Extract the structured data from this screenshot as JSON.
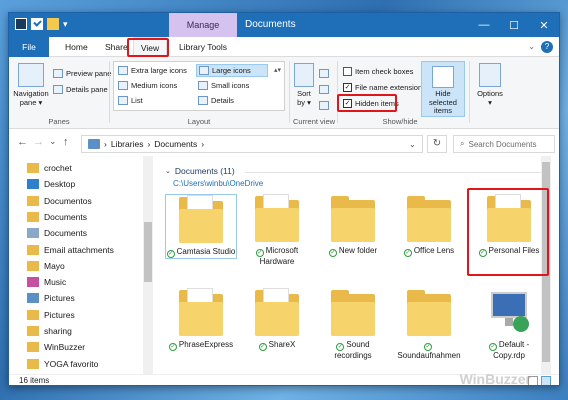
{
  "window": {
    "title": "Documents",
    "manage_tab": "Manage",
    "controls": {
      "minimize": "—",
      "maximize": "☐",
      "close": "✕"
    }
  },
  "tabs": {
    "file": "File",
    "home": "Home",
    "share": "Share",
    "view": "View",
    "library_tools": "Library Tools",
    "help": "?"
  },
  "ribbon": {
    "panes": {
      "navigation_pane": "Navigation",
      "navigation_pane_sub": "pane ▾",
      "preview_pane": "Preview pane",
      "details_pane": "Details pane",
      "label": "Panes"
    },
    "layout": {
      "items": [
        "Extra large icons",
        "Large icons",
        "Medium icons",
        "Small icons",
        "List",
        "Details"
      ],
      "label": "Layout"
    },
    "current_view": {
      "sort_by": "Sort",
      "sort_by_sub": "by ▾",
      "label": "Current view"
    },
    "show_hide": {
      "item_check_boxes": "Item check boxes",
      "file_name_extensions": "File name extensions",
      "hidden_items": "Hidden items",
      "hide_selected_1": "Hide selected",
      "hide_selected_2": "items",
      "label": "Show/hide"
    },
    "options": {
      "label": "Options",
      "sub": "▾"
    }
  },
  "address": {
    "back": "←",
    "forward": "→",
    "recent": "⌄",
    "up": "↑",
    "path": [
      "Libraries",
      "Documents"
    ],
    "separator": "›",
    "refresh": "↻",
    "search_placeholder": "Search Documents"
  },
  "nav_pane": {
    "items": [
      {
        "label": "crochet",
        "color": "#e9b949"
      },
      {
        "label": "Desktop",
        "color": "#2f7fd0"
      },
      {
        "label": "Documentos",
        "color": "#e9b949"
      },
      {
        "label": "Documents",
        "color": "#e9b949"
      },
      {
        "label": "Documents",
        "color": "#8aa9c9"
      },
      {
        "label": "Email attachments",
        "color": "#e9b949"
      },
      {
        "label": "Mayo",
        "color": "#e9b949"
      },
      {
        "label": "Music",
        "color": "#c64fa0"
      },
      {
        "label": "Pictures",
        "color": "#5c8fc6"
      },
      {
        "label": "Pictures",
        "color": "#e9b949"
      },
      {
        "label": "sharing",
        "color": "#e9b949"
      },
      {
        "label": "WinBuzzer",
        "color": "#e9b949"
      },
      {
        "label": "YOGA favorito",
        "color": "#e9b949"
      }
    ]
  },
  "content": {
    "group_title": "Documents (11)",
    "group_path": "C:\\Users\\winbu\\OneDrive",
    "tiles": [
      {
        "label": "Camtasia Studio"
      },
      {
        "label": "Microsoft Hardware"
      },
      {
        "label": "New folder"
      },
      {
        "label": "Office Lens"
      },
      {
        "label": "Personal Files"
      },
      {
        "label": "PhraseExpress"
      },
      {
        "label": "ShareX"
      },
      {
        "label": "Sound recordings"
      },
      {
        "label": "Soundaufnahmen"
      },
      {
        "label": "Default - Copy.rdp"
      }
    ]
  },
  "status": {
    "count": "16 items",
    "watermark": "WinBuzzer"
  }
}
